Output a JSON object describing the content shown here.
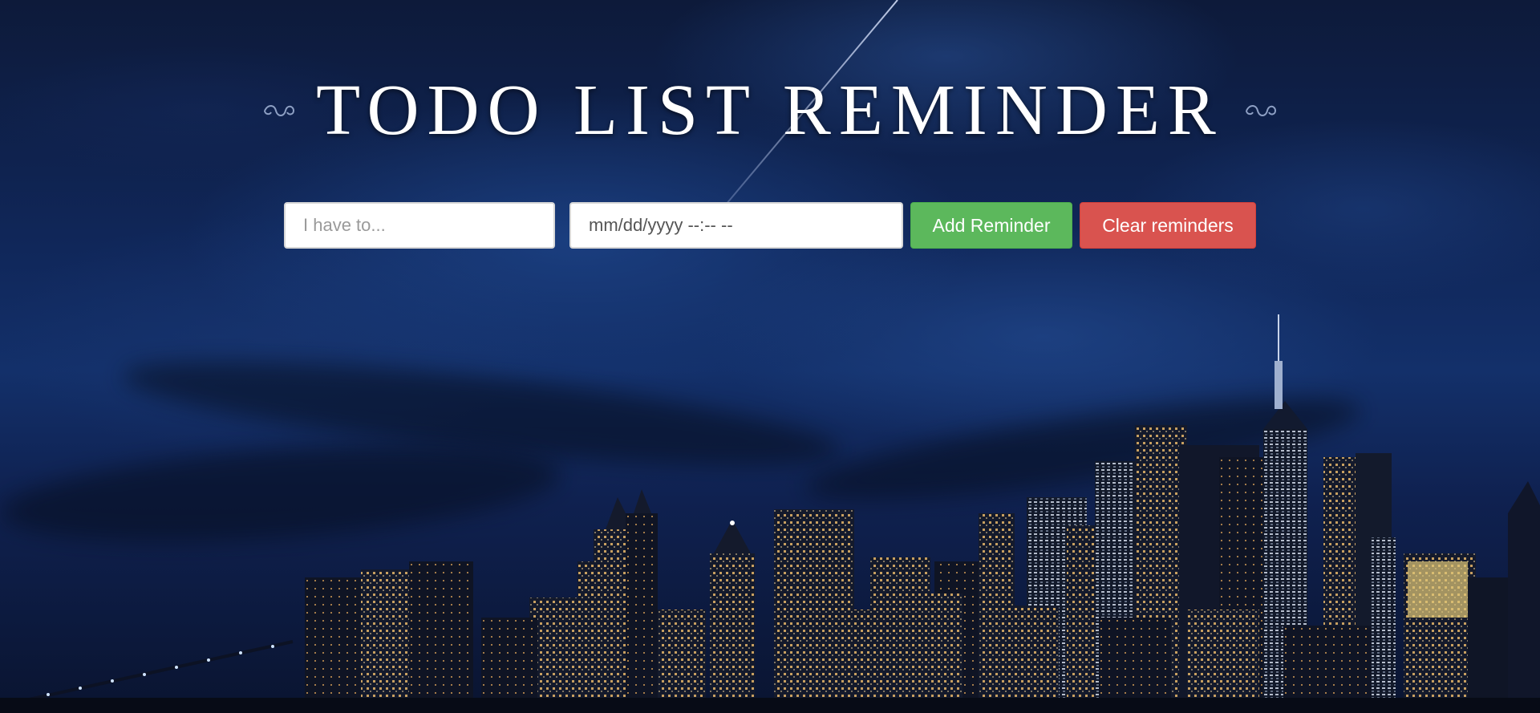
{
  "header": {
    "title": "TODO LIST REMINDER"
  },
  "form": {
    "task_placeholder": "I have to...",
    "task_value": "",
    "datetime_placeholder": "mm/dd/yyyy --:-- --",
    "add_label": "Add Reminder",
    "clear_label": "Clear reminders"
  },
  "colors": {
    "add_button": "#5cb85c",
    "clear_button": "#d9534f",
    "title": "#ffffff"
  }
}
